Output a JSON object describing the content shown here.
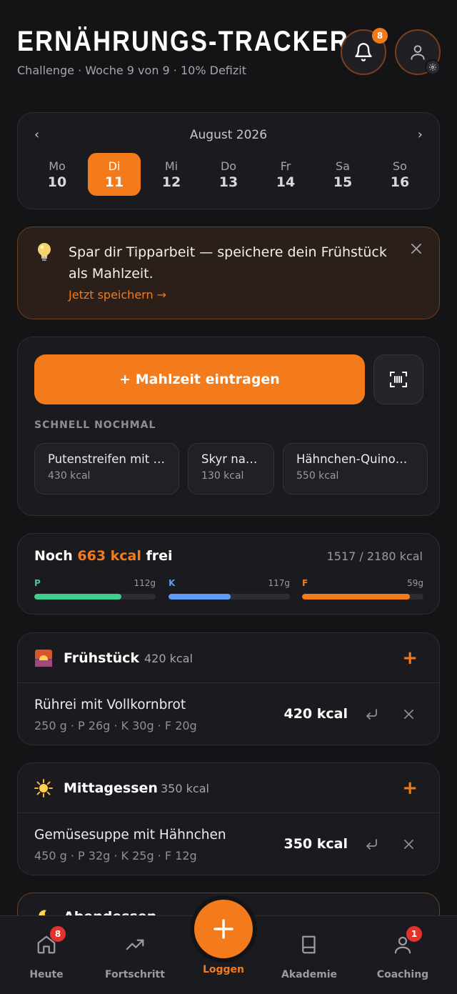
{
  "header": {
    "title": "ERNÄHRUNGS-TRACKER",
    "subtitle": "Challenge · Woche 9 von 9 · 10% Defizit",
    "notifications_count": "8",
    "icons": {
      "notifications": "bell-icon",
      "profile": "user-icon",
      "settings": "gear-icon"
    }
  },
  "calendar": {
    "month": "August 2026",
    "prev": "‹",
    "next": "›",
    "days": [
      {
        "name": "Mo",
        "num": "10"
      },
      {
        "name": "Di",
        "num": "11"
      },
      {
        "name": "Mi",
        "num": "12"
      },
      {
        "name": "Do",
        "num": "13"
      },
      {
        "name": "Fr",
        "num": "14"
      },
      {
        "name": "Sa",
        "num": "15"
      },
      {
        "name": "So",
        "num": "16"
      }
    ],
    "selected_index": 1
  },
  "tip": {
    "icon": "lightbulb-icon",
    "text": "Spar dir Tipparbeit — speichere dein Frühstück als Mahlzeit.",
    "link": "Jetzt speichern →"
  },
  "add_meal": {
    "button_label": "+ Mahlzeit eintragen",
    "scan_icon": "barcode-scan-icon",
    "quick_label": "SCHNELL NOCHMAL",
    "quick_items": [
      {
        "name": "Putenstreifen mit P...",
        "kcal": "430 kcal"
      },
      {
        "name": "Skyr natur",
        "kcal": "130 kcal"
      },
      {
        "name": "Hähnchen-Quinoa ...",
        "kcal": "550 kcal"
      }
    ]
  },
  "remaining": {
    "prefix": "Noch",
    "value": "663 kcal",
    "suffix": "frei",
    "total": "1517 / 2180 kcal",
    "macros": [
      {
        "letter": "P",
        "value": "112g",
        "fill": 0.72,
        "color": "#3ecf8e"
      },
      {
        "letter": "K",
        "value": "117g",
        "fill": 0.51,
        "color": "#5b9cf5"
      },
      {
        "letter": "F",
        "value": "59g",
        "fill": 0.89,
        "color": "#f47b1b"
      }
    ]
  },
  "meals": [
    {
      "name": "Frühstück",
      "kcal": "420 kcal",
      "icon": "sunrise-icon",
      "entry": {
        "name": "Rührei mit Vollkornbrot",
        "meta": "250 g · P 26g · K 30g · F 20g",
        "kcal": "420 kcal"
      }
    },
    {
      "name": "Mittagessen",
      "kcal": "350 kcal",
      "icon": "sun-icon",
      "entry": {
        "name": "Gemüsesuppe mit Hähnchen",
        "meta": "450 g · P 32g · K 25g · F 12g",
        "kcal": "350 kcal"
      }
    }
  ],
  "partial_meal": {
    "icon": "moon-icon",
    "name": "Abendessen"
  },
  "nav": {
    "items": [
      {
        "label": "Heute",
        "icon": "home-icon",
        "badge": "8"
      },
      {
        "label": "Fortschritt",
        "icon": "trending-up-icon"
      },
      {
        "label": "Loggen",
        "icon": "plus-icon"
      },
      {
        "label": "Akademie",
        "icon": "book-icon"
      },
      {
        "label": "Coaching",
        "icon": "user-icon",
        "badge": "1"
      }
    ]
  },
  "colors": {
    "accent": "#f47b1b",
    "background": "#141417",
    "card": "#1b1b1f",
    "badge_red": "#e5322d"
  }
}
